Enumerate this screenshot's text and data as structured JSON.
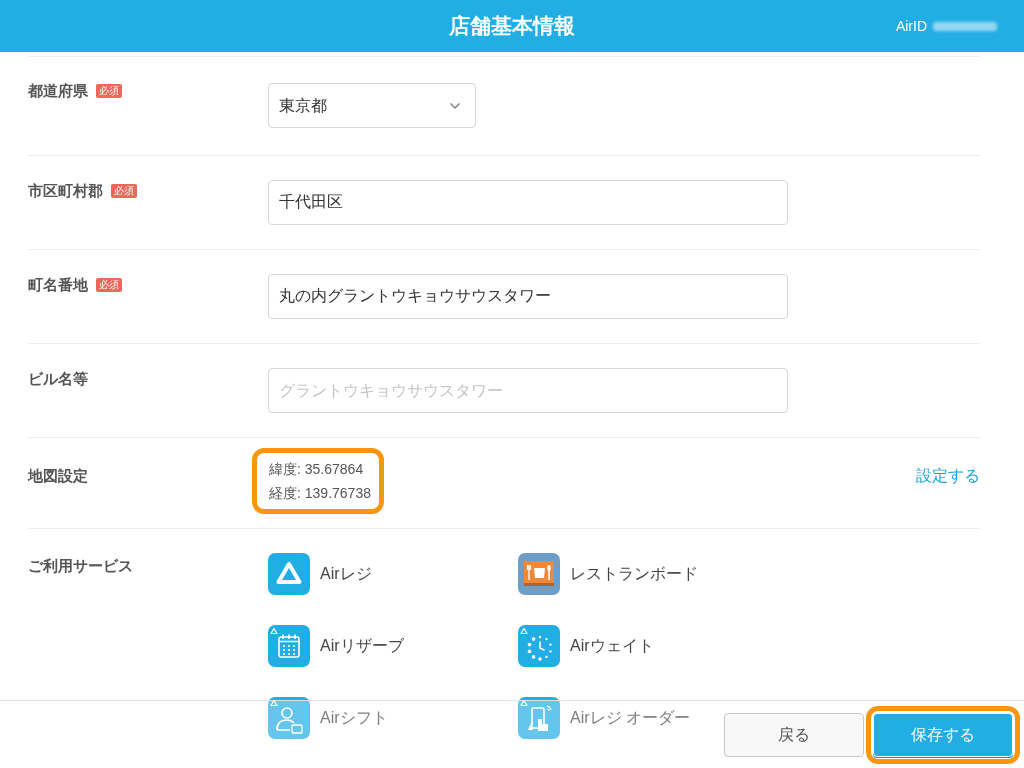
{
  "header": {
    "title": "店舗基本情報",
    "account_label": "AirID"
  },
  "fields": [
    {
      "label": "都道府県",
      "badge": "必須",
      "kind": "select",
      "value": "東京都"
    },
    {
      "label": "市区町村郡",
      "badge": "必須",
      "kind": "text",
      "value": "千代田区"
    },
    {
      "label": "町名番地",
      "badge": "必須",
      "kind": "text",
      "value": "丸の内グラントウキョウサウスタワー"
    },
    {
      "label": "ビル名等",
      "kind": "text",
      "placeholder": "グラントウキョウサウスタワー"
    }
  ],
  "map_setting": {
    "label": "地図設定",
    "latitude": "緯度: 35.67864",
    "longitude": "経度: 139.76738",
    "highlighted": true,
    "link": "設定する"
  },
  "services": {
    "label": "ご利用サービス",
    "items": [
      {
        "name": "Airレジ",
        "kind": "register"
      },
      {
        "name": "レストランボード",
        "kind": "restaurant-board"
      },
      {
        "name": "Airリザーブ",
        "kind": "reserve"
      },
      {
        "name": "Airウェイト",
        "kind": "wait"
      },
      {
        "name": "Airシフト",
        "kind": "shift"
      },
      {
        "name": "Airレジ オーダー",
        "kind": "order"
      }
    ]
  },
  "footer": {
    "buttons": [
      {
        "label": "戻る",
        "kind": "secondary",
        "highlighted": false
      },
      {
        "label": "保存する",
        "kind": "primary",
        "highlighted": true
      }
    ]
  }
}
